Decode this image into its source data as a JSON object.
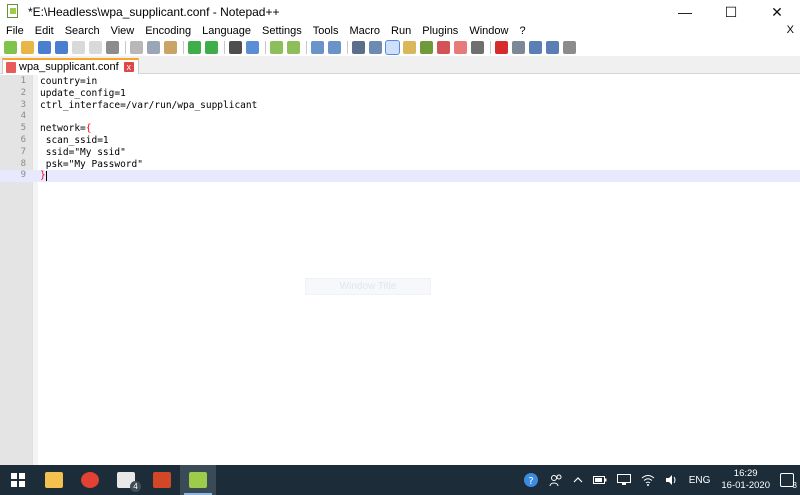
{
  "window": {
    "title": "*E:\\Headless\\wpa_supplicant.conf - Notepad++",
    "minimize_label": "—",
    "maximize_label": "☐",
    "close_label": "✕"
  },
  "menu": {
    "items": [
      "File",
      "Edit",
      "Search",
      "View",
      "Encoding",
      "Language",
      "Settings",
      "Tools",
      "Macro",
      "Run",
      "Plugins",
      "Window",
      "?"
    ],
    "close_doc": "X"
  },
  "toolbar": {
    "groups": [
      [
        "new-file-icon",
        "open-file-icon",
        "save-icon",
        "save-all-icon",
        "close-icon",
        "close-all-icon",
        "print-icon"
      ],
      [
        "cut-icon",
        "copy-icon",
        "paste-icon"
      ],
      [
        "undo-icon",
        "redo-icon"
      ],
      [
        "find-icon",
        "replace-icon"
      ],
      [
        "zoom-in-icon",
        "zoom-out-icon"
      ],
      [
        "sync-vertical-icon",
        "sync-horizontal-icon"
      ],
      [
        "word-wrap-icon",
        "show-all-chars-icon",
        "indent-guide-icon",
        "user-defined-language-icon",
        "document-map-icon",
        "function-list-icon",
        "folder-as-workspace-icon",
        "monitoring-icon"
      ],
      [
        "record-macro-icon",
        "stop-record-icon",
        "play-macro-icon",
        "run-macro-multiple-icon",
        "save-macro-icon"
      ]
    ],
    "colors": {
      "new-file-icon": "#7fc34d",
      "open-file-icon": "#e8b646",
      "save-icon": "#4a7fd0",
      "save-all-icon": "#4a7fd0",
      "close-icon": "#d9d9d9",
      "close-all-icon": "#d9d9d9",
      "print-icon": "#8c8c8c",
      "cut-icon": "#b8b8b8",
      "copy-icon": "#9aa6b8",
      "paste-icon": "#c9a466",
      "undo-icon": "#3fae4a",
      "redo-icon": "#3fae4a",
      "find-icon": "#4e4e4e",
      "replace-icon": "#5a8fd6",
      "zoom-in-icon": "#8cbf5a",
      "zoom-out-icon": "#8cbf5a",
      "sync-vertical-icon": "#6a93c9",
      "sync-horizontal-icon": "#6a93c9",
      "word-wrap-icon": "#5c6f8a",
      "show-all-chars-icon": "#6d8ab3",
      "indent-guide-icon": "#3d6fc4",
      "user-defined-language-icon": "#d8b85a",
      "document-map-icon": "#6f9a3a",
      "function-list-icon": "#d35454",
      "folder-as-workspace-icon": "#e77a7a",
      "monitoring-icon": "#6f6f6f",
      "record-macro-icon": "#d62b2b",
      "stop-record-icon": "#7c8896",
      "play-macro-icon": "#5b7eb5",
      "run-macro-multiple-icon": "#5b7eb5",
      "save-macro-icon": "#8c8c8c"
    },
    "active_icon": "indent-guide-icon"
  },
  "tab": {
    "label": "wpa_supplicant.conf",
    "close_label": "x"
  },
  "editor": {
    "lines": [
      {
        "n": "1",
        "text": "country=in"
      },
      {
        "n": "2",
        "text": "update_config=1"
      },
      {
        "n": "3",
        "text": "ctrl_interface=/var/run/wpa_supplicant"
      },
      {
        "n": "4",
        "text": ""
      },
      {
        "n": "5",
        "text": "network={"
      },
      {
        "n": "6",
        "text": " scan_ssid=1"
      },
      {
        "n": "7",
        "text": " ssid=\"My ssid\""
      },
      {
        "n": "8",
        "text": " psk=\"My Password\""
      },
      {
        "n": "9",
        "text": "}"
      }
    ],
    "current_line": "9",
    "ghost_text": "Window Title",
    "colors": {
      "brace": "#ff0000",
      "current_line": "#e8e8ff",
      "gutter": "#e4e4e4"
    }
  },
  "taskbar": {
    "apps": [
      {
        "name": "file-explorer-icon",
        "color": "#f2c14e"
      },
      {
        "name": "chrome-icon",
        "color": "#e34133"
      },
      {
        "name": "mail-icon",
        "color": "#e8e8e8",
        "badge": "4"
      },
      {
        "name": "powerpoint-icon",
        "color": "#d24726"
      },
      {
        "name": "notepadpp-icon",
        "color": "#9ccc4a"
      }
    ],
    "tray": {
      "language": "ENG",
      "time": "16:29",
      "date": "16-01-2020",
      "notification_count": "3"
    }
  }
}
